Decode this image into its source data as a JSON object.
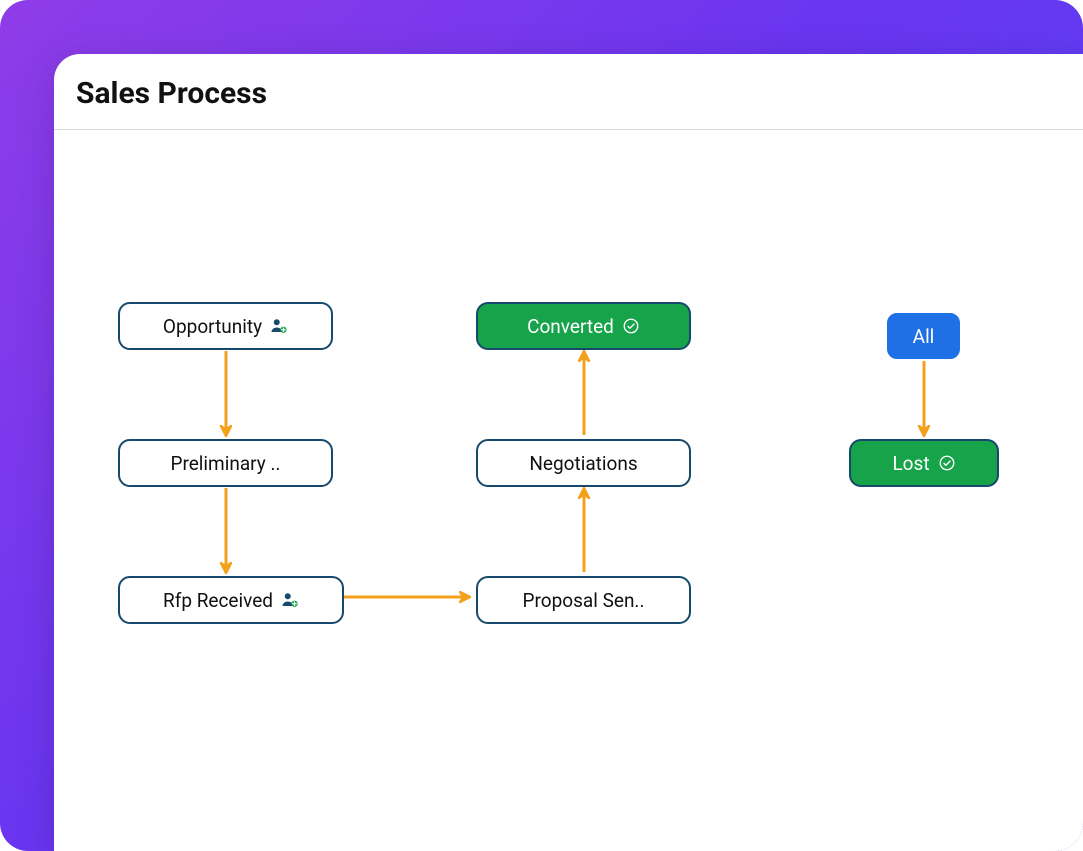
{
  "title": "Sales Process",
  "nodes": {
    "opportunity": {
      "label": "Opportunity",
      "icon": "user-plus"
    },
    "preliminary": {
      "label": "Preliminary .."
    },
    "rfp": {
      "label": "Rfp Received",
      "icon": "user-plus"
    },
    "proposal": {
      "label": "Proposal Sen.."
    },
    "negotiations": {
      "label": "Negotiations"
    },
    "converted": {
      "label": "Converted",
      "icon": "check",
      "style": "green"
    },
    "all": {
      "label": "All",
      "style": "blue"
    },
    "lost": {
      "label": "Lost",
      "icon": "check",
      "style": "green"
    }
  },
  "colors": {
    "arrow": "#f3a11b",
    "nodeBorder": "#17496c",
    "green": "#17a34a",
    "blue": "#1f6fe5"
  }
}
